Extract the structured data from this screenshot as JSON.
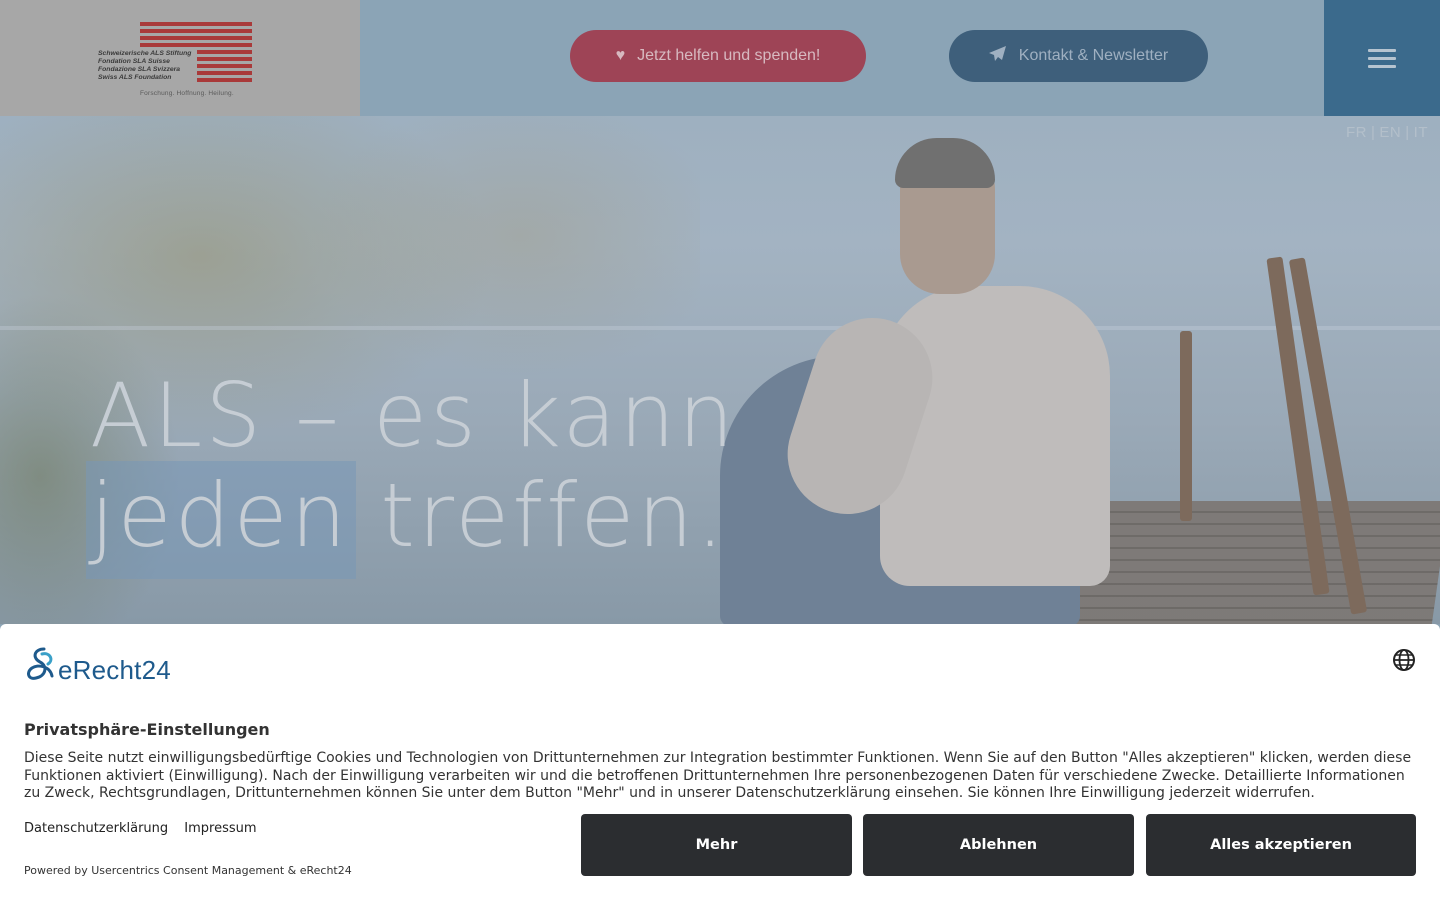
{
  "header": {
    "logo_lines": [
      "Schweizerische ALS Stiftung",
      "Fondation SLA Suisse",
      "Fondazione SLA Svizzera",
      "Swiss ALS Foundation"
    ],
    "logo_tagline": "Forschung. Hoffnung. Heilung.",
    "donate_label": "Jetzt helfen und spenden!",
    "contact_label": "Kontakt & Newsletter",
    "donate_icon": "heart-icon",
    "contact_icon": "paper-plane-icon",
    "menu_icon": "hamburger-menu-icon",
    "colors": {
      "donate": "#9e4456",
      "contact": "#3e5f7b",
      "menu": "#3b6a8c",
      "logo_red": "#a93a3a"
    }
  },
  "languages": {
    "items": [
      "FR",
      "EN",
      "IT"
    ],
    "separator": "|"
  },
  "hero": {
    "title_line1": "ALS – es kann",
    "title_line2_word1": "jeden",
    "title_line2_word2": " treffen."
  },
  "consent": {
    "brand": "eRecht24",
    "title": "Privatsphäre-Einstellungen",
    "text": "Diese Seite nutzt einwilligungsbedürftige Cookies und Technologien von Drittunternehmen zur Integration bestimmter Funktionen. Wenn Sie auf den Button \"Alles akzeptieren\" klicken, werden diese Funktionen aktiviert (Einwilligung). Nach der Einwilligung verarbeiten wir und die betroffenen Drittunternehmen Ihre personenbezogenen Daten für verschiedene Zwecke. Detaillierte Informationen zu Zweck, Rechtsgrundlagen, Drittunternehmen können Sie unter dem Button \"Mehr\" und in unserer Datenschutzerklärung einsehen. Sie können Ihre Einwilligung jederzeit widerrufen.",
    "link_privacy": "Datenschutzerklärung",
    "link_imprint": "Impressum",
    "powered_by": "Powered by Usercentrics Consent Management & eRecht24",
    "btn_more": "Mehr",
    "btn_deny": "Ablehnen",
    "btn_accept": "Alles akzeptieren",
    "button_color": "#2b2d30",
    "brand_color": "#1e5a8c"
  }
}
